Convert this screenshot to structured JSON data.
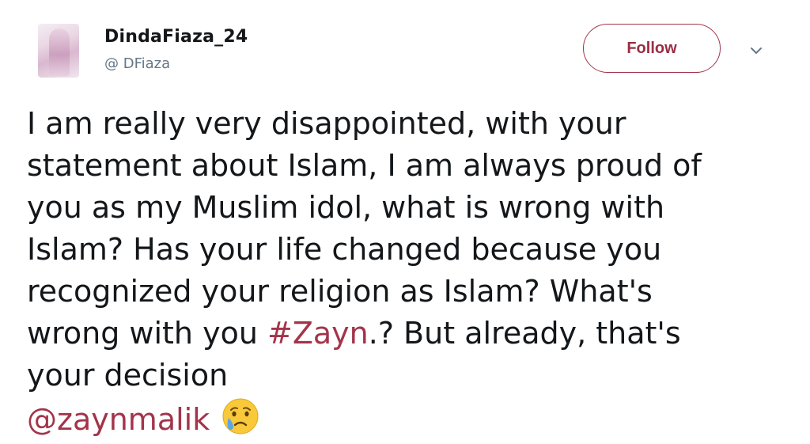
{
  "user": {
    "display_name": "DindaFiaza_24",
    "handle": "@ DFiaza"
  },
  "actions": {
    "follow_label": "Follow",
    "menu_icon": "chevron-down-icon"
  },
  "tweet": {
    "lines": [
      "I am really very disappointed, with your",
      "statement about Islam, I am always proud of",
      "you as my Muslim idol, what is wrong with",
      "Islam? Has your life changed because you",
      "recognized your religion as Islam? What's"
    ],
    "line6_before": "wrong with you ",
    "hashtag": "#Zayn",
    "line6_after": ".? But already, that's",
    "line7": "your decision",
    "mention": "@zaynmalik",
    "emoji_icon": "crying-face-icon"
  },
  "colors": {
    "link": "#a3344a",
    "text": "#14171a",
    "secondary": "#657786"
  }
}
